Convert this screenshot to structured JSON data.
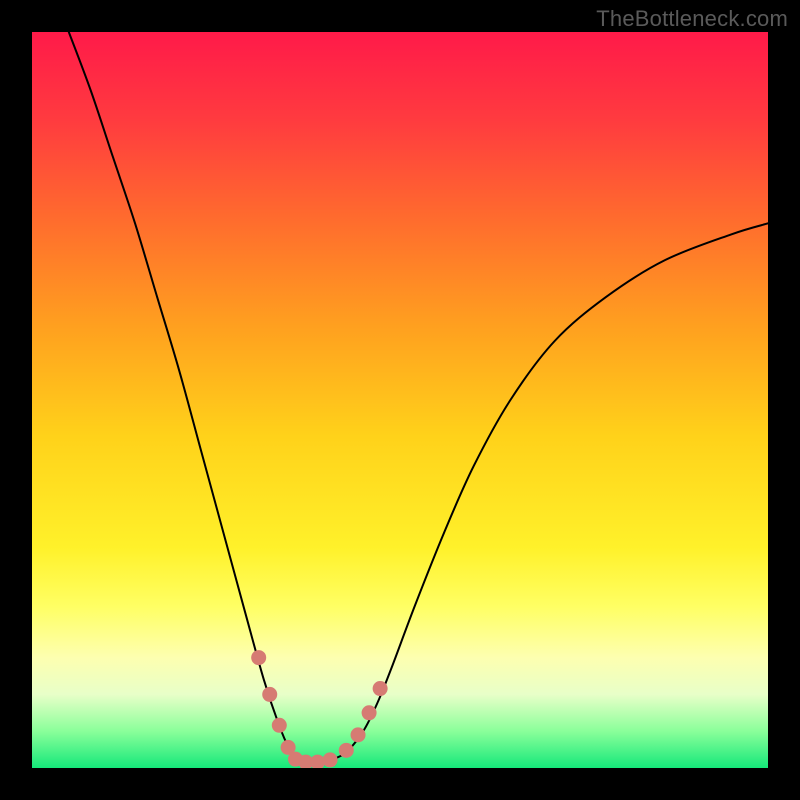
{
  "watermark": "TheBottleneck.com",
  "chart_data": {
    "type": "line",
    "title": "",
    "xlabel": "",
    "ylabel": "",
    "xlim": [
      0,
      100
    ],
    "ylim": [
      0,
      100
    ],
    "gradient_stops": [
      {
        "offset": 0.0,
        "color": "#ff1a49"
      },
      {
        "offset": 0.12,
        "color": "#ff3b3f"
      },
      {
        "offset": 0.25,
        "color": "#ff6a2e"
      },
      {
        "offset": 0.4,
        "color": "#ffa01f"
      },
      {
        "offset": 0.55,
        "color": "#ffd21a"
      },
      {
        "offset": 0.7,
        "color": "#fff12a"
      },
      {
        "offset": 0.78,
        "color": "#ffff63"
      },
      {
        "offset": 0.85,
        "color": "#fdffb0"
      },
      {
        "offset": 0.9,
        "color": "#e8ffc8"
      },
      {
        "offset": 0.95,
        "color": "#8aff9a"
      },
      {
        "offset": 1.0,
        "color": "#15e87a"
      }
    ],
    "series": [
      {
        "name": "bottleneck-curve",
        "color": "#000000",
        "width": 2.0,
        "x": [
          5.0,
          8.0,
          11.0,
          14.0,
          17.0,
          20.0,
          23.0,
          26.0,
          29.0,
          31.5,
          33.5,
          35.0,
          36.0,
          37.0,
          38.0,
          40.0,
          42.5,
          45.0,
          47.0,
          49.0,
          52.0,
          56.0,
          60.0,
          65.0,
          71.0,
          78.0,
          86.0,
          95.0,
          100.0
        ],
        "y": [
          100.0,
          92.0,
          83.0,
          74.0,
          64.0,
          54.0,
          43.0,
          32.0,
          21.0,
          12.0,
          6.0,
          2.5,
          1.2,
          0.8,
          0.8,
          1.0,
          2.0,
          5.0,
          9.0,
          14.0,
          22.0,
          32.0,
          41.0,
          50.0,
          58.0,
          64.0,
          69.0,
          72.5,
          74.0
        ]
      }
    ],
    "markers": {
      "name": "highlight-dots",
      "color": "#d67b73",
      "radius": 7.5,
      "x": [
        30.8,
        32.3,
        33.6,
        34.8,
        35.8,
        37.2,
        38.8,
        40.5,
        42.7,
        44.3,
        45.8,
        47.3
      ],
      "y": [
        15.0,
        10.0,
        5.8,
        2.8,
        1.2,
        0.8,
        0.8,
        1.1,
        2.4,
        4.5,
        7.5,
        10.8
      ]
    }
  }
}
